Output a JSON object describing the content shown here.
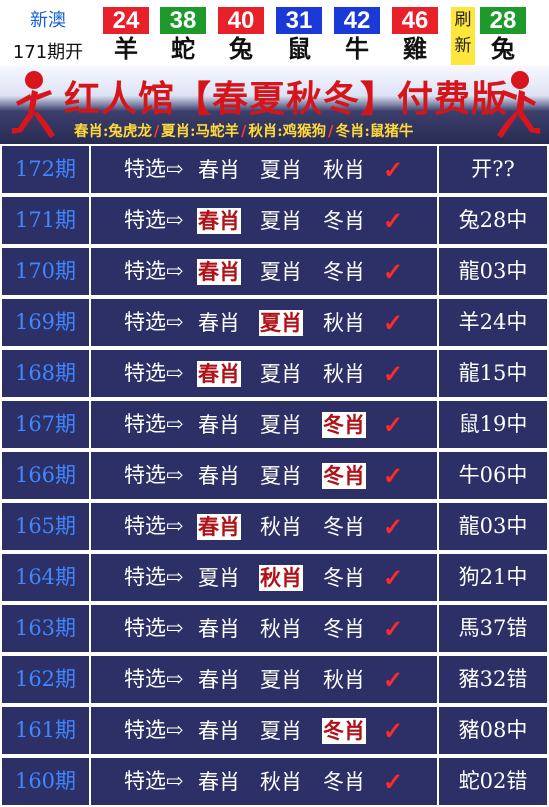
{
  "top_bar": {
    "lottery_name": "新澳",
    "issue_label": "171期开",
    "balls": [
      {
        "number": "24",
        "zodiac": "羊",
        "color": "#e8202a"
      },
      {
        "number": "38",
        "zodiac": "蛇",
        "color": "#1e9a2c"
      },
      {
        "number": "40",
        "zodiac": "兔",
        "color": "#e8202a"
      },
      {
        "number": "31",
        "zodiac": "鼠",
        "color": "#1a39d6"
      },
      {
        "number": "42",
        "zodiac": "牛",
        "color": "#1a39d6"
      },
      {
        "number": "46",
        "zodiac": "雞",
        "color": "#e8202a"
      }
    ],
    "refresh_top": "刷",
    "refresh_bottom": "新",
    "special_ball": {
      "number": "28",
      "zodiac": "兔",
      "color": "#1e9a2c"
    }
  },
  "banner": {
    "title": "红人馆【春夏秋冬】付费版",
    "seasons": [
      "春肖:兔虎龙",
      "夏肖:马蛇羊",
      "秋肖:鸡猴狗",
      "冬肖:鼠猪牛"
    ],
    "separator": "/"
  },
  "rows_common": {
    "lead": "特选⇨",
    "check": "✓"
  },
  "rows": [
    {
      "issue": "172期",
      "picks": [
        "春肖",
        "夏肖",
        "秋肖"
      ],
      "highlight": -1,
      "result": "开??"
    },
    {
      "issue": "171期",
      "picks": [
        "春肖",
        "夏肖",
        "冬肖"
      ],
      "highlight": 0,
      "result": "兔28中"
    },
    {
      "issue": "170期",
      "picks": [
        "春肖",
        "夏肖",
        "冬肖"
      ],
      "highlight": 0,
      "result": "龍03中"
    },
    {
      "issue": "169期",
      "picks": [
        "春肖",
        "夏肖",
        "秋肖"
      ],
      "highlight": 1,
      "result": "羊24中"
    },
    {
      "issue": "168期",
      "picks": [
        "春肖",
        "夏肖",
        "秋肖"
      ],
      "highlight": 0,
      "result": "龍15中"
    },
    {
      "issue": "167期",
      "picks": [
        "春肖",
        "夏肖",
        "冬肖"
      ],
      "highlight": 2,
      "result": "鼠19中"
    },
    {
      "issue": "166期",
      "picks": [
        "春肖",
        "夏肖",
        "冬肖"
      ],
      "highlight": 2,
      "result": "牛06中"
    },
    {
      "issue": "165期",
      "picks": [
        "春肖",
        "秋肖",
        "冬肖"
      ],
      "highlight": 0,
      "result": "龍03中"
    },
    {
      "issue": "164期",
      "picks": [
        "夏肖",
        "秋肖",
        "冬肖"
      ],
      "highlight": 1,
      "result": "狗21中"
    },
    {
      "issue": "163期",
      "picks": [
        "春肖",
        "秋肖",
        "冬肖"
      ],
      "highlight": -1,
      "result": "馬37错"
    },
    {
      "issue": "162期",
      "picks": [
        "春肖",
        "夏肖",
        "秋肖"
      ],
      "highlight": -1,
      "result": "豬32错"
    },
    {
      "issue": "161期",
      "picks": [
        "春肖",
        "夏肖",
        "冬肖"
      ],
      "highlight": 2,
      "result": "豬08中"
    },
    {
      "issue": "160期",
      "picks": [
        "春肖",
        "秋肖",
        "冬肖"
      ],
      "highlight": -1,
      "result": "蛇02错"
    }
  ]
}
